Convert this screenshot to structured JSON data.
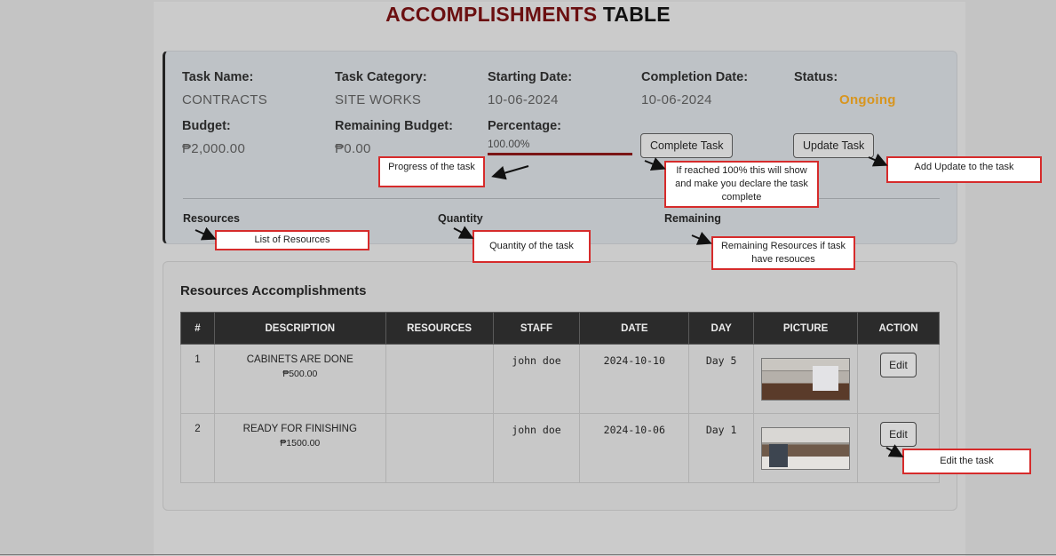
{
  "page": {
    "title_accent": "ACCOMPLISHMENTS",
    "title_rest": "TABLE"
  },
  "task": {
    "name_label": "Task Name:",
    "name_value": "CONTRACTS",
    "category_label": "Task Category:",
    "category_value": "SITE WORKS",
    "start_label": "Starting Date:",
    "start_value": "10-06-2024",
    "completion_label": "Completion Date:",
    "completion_value": "10-06-2024",
    "status_label": "Status:",
    "status_value": "Ongoing",
    "budget_label": "Budget:",
    "budget_value": "₱2,000.00",
    "remaining_label": "Remaining Budget:",
    "remaining_value": "₱0.00",
    "percentage_label": "Percentage:",
    "percentage_value": "100.00%",
    "progress_fraction": 1.0,
    "complete_button": "Complete Task",
    "update_button": "Update Task",
    "resources_header": "Resources",
    "quantity_header": "Quantity",
    "remaining_header": "Remaining"
  },
  "accomplishments": {
    "title": "Resources Accomplishments",
    "columns": [
      "#",
      "DESCRIPTION",
      "RESOURCES",
      "STAFF",
      "DATE",
      "DAY",
      "PICTURE",
      "ACTION"
    ],
    "rows": [
      {
        "num": "1",
        "description": "CABINETS ARE DONE",
        "amount": "₱500.00",
        "resources": "",
        "staff": "john doe",
        "date": "2024-10-10",
        "day": "Day 5",
        "action": "Edit"
      },
      {
        "num": "2",
        "description": "READY FOR FINISHING",
        "amount": "₱1500.00",
        "resources": "",
        "staff": "john doe",
        "date": "2024-10-06",
        "day": "Day 1",
        "action": "Edit"
      }
    ]
  },
  "annotations": {
    "progress": "Progress of the task",
    "complete": "If reached 100% this will show and make you declare the task complete",
    "update": "Add Update to the task",
    "resources": "List of Resources",
    "quantity": "Quantity of the task",
    "remaining": "Remaining Resources if task have resouces",
    "edit": "Edit the task"
  },
  "colors": {
    "title_accent": "#6b0f10",
    "status_ongoing": "#d8951e",
    "progress_bar": "#7a1515",
    "annotation_border": "#d62b2b"
  }
}
